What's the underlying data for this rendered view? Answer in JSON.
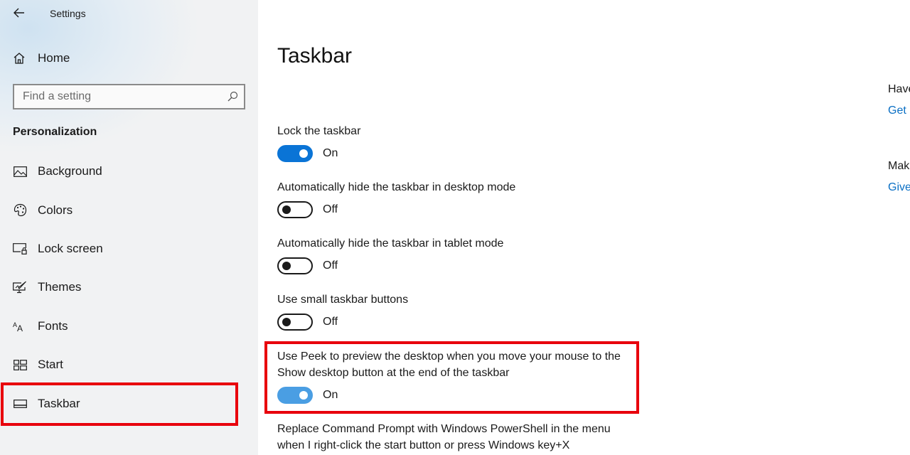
{
  "app": {
    "title": "Settings",
    "back_label": "Back"
  },
  "sidebar": {
    "home_label": "Home",
    "search": {
      "placeholder": "Find a setting",
      "value": ""
    },
    "section_title": "Personalization",
    "items": [
      {
        "label": "Background",
        "icon": "image-icon"
      },
      {
        "label": "Colors",
        "icon": "palette-icon"
      },
      {
        "label": "Lock screen",
        "icon": "lock-screen-icon"
      },
      {
        "label": "Themes",
        "icon": "themes-icon"
      },
      {
        "label": "Fonts",
        "icon": "fonts-icon"
      },
      {
        "label": "Start",
        "icon": "start-icon"
      },
      {
        "label": "Taskbar",
        "icon": "taskbar-icon",
        "selected": true
      }
    ]
  },
  "main": {
    "title": "Taskbar",
    "settings": [
      {
        "label": "Lock the taskbar",
        "state": "On",
        "on": true
      },
      {
        "label": "Automatically hide the taskbar in desktop mode",
        "state": "Off",
        "on": false
      },
      {
        "label": "Automatically hide the taskbar in tablet mode",
        "state": "Off",
        "on": false
      },
      {
        "label": "Use small taskbar buttons",
        "state": "Off",
        "on": false
      },
      {
        "label": "Use Peek to preview the desktop when you move your mouse to the Show desktop button at the end of the taskbar",
        "state": "On",
        "on": true
      },
      {
        "label": "Replace Command Prompt with Windows PowerShell in the menu when I right-click the start button or press Windows key+X"
      }
    ]
  },
  "related": [
    {
      "question": "Have",
      "link": "Get"
    },
    {
      "question": "Mak",
      "link": "Give"
    }
  ],
  "colors": {
    "accent": "#0a74d6",
    "highlight": "#e8000c",
    "link": "#0a6fc4"
  }
}
